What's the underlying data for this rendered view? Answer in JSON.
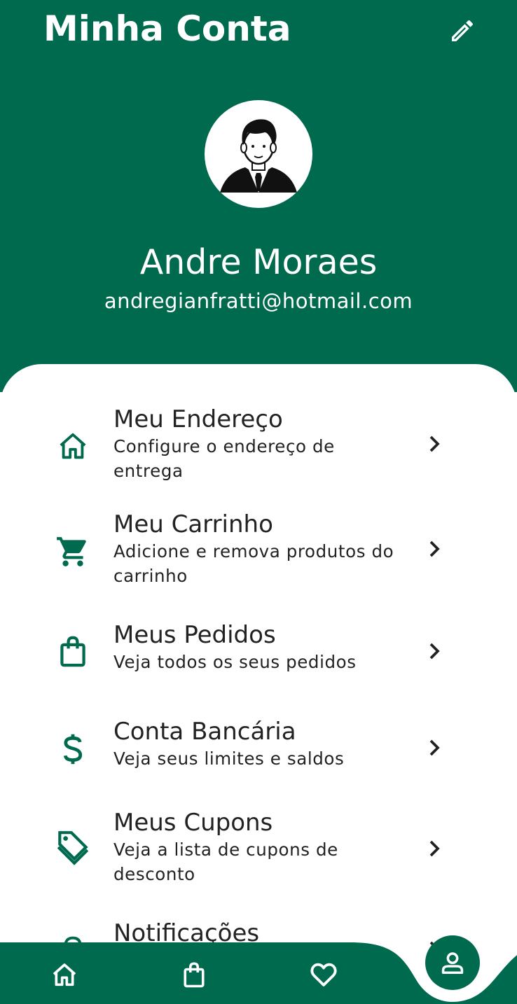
{
  "header": {
    "title": "Minha Conta",
    "edit_icon": "pencil-icon"
  },
  "profile": {
    "name": "Andre Moraes",
    "email": "andregianfratti@hotmail.com",
    "avatar_icon": "user-avatar"
  },
  "menu": {
    "items": [
      {
        "icon": "home-icon",
        "title": "Meu Endereço",
        "subtitle": "Configure o endereço de entrega"
      },
      {
        "icon": "cart-icon",
        "title": "Meu Carrinho",
        "subtitle": "Adicione e remova produtos do carrinho"
      },
      {
        "icon": "shopping-bag-icon",
        "title": "Meus Pedidos",
        "subtitle": "Veja todos os seus pedidos"
      },
      {
        "icon": "dollar-icon",
        "title": "Conta Bancária",
        "subtitle": "Veja seus limites e saldos"
      },
      {
        "icon": "tag-icon",
        "title": "Meus Cupons",
        "subtitle": "Veja a lista de cupons de desconto"
      },
      {
        "icon": "bell-icon",
        "title": "Notificações",
        "subtitle": ""
      }
    ]
  },
  "bottom_nav": {
    "items": [
      "home-icon",
      "shopping-bag-icon",
      "heart-icon",
      "profile-icon"
    ],
    "active": "profile-icon"
  },
  "colors": {
    "primary": "#006a4e",
    "text": "#222222",
    "background": "#ffffff"
  }
}
